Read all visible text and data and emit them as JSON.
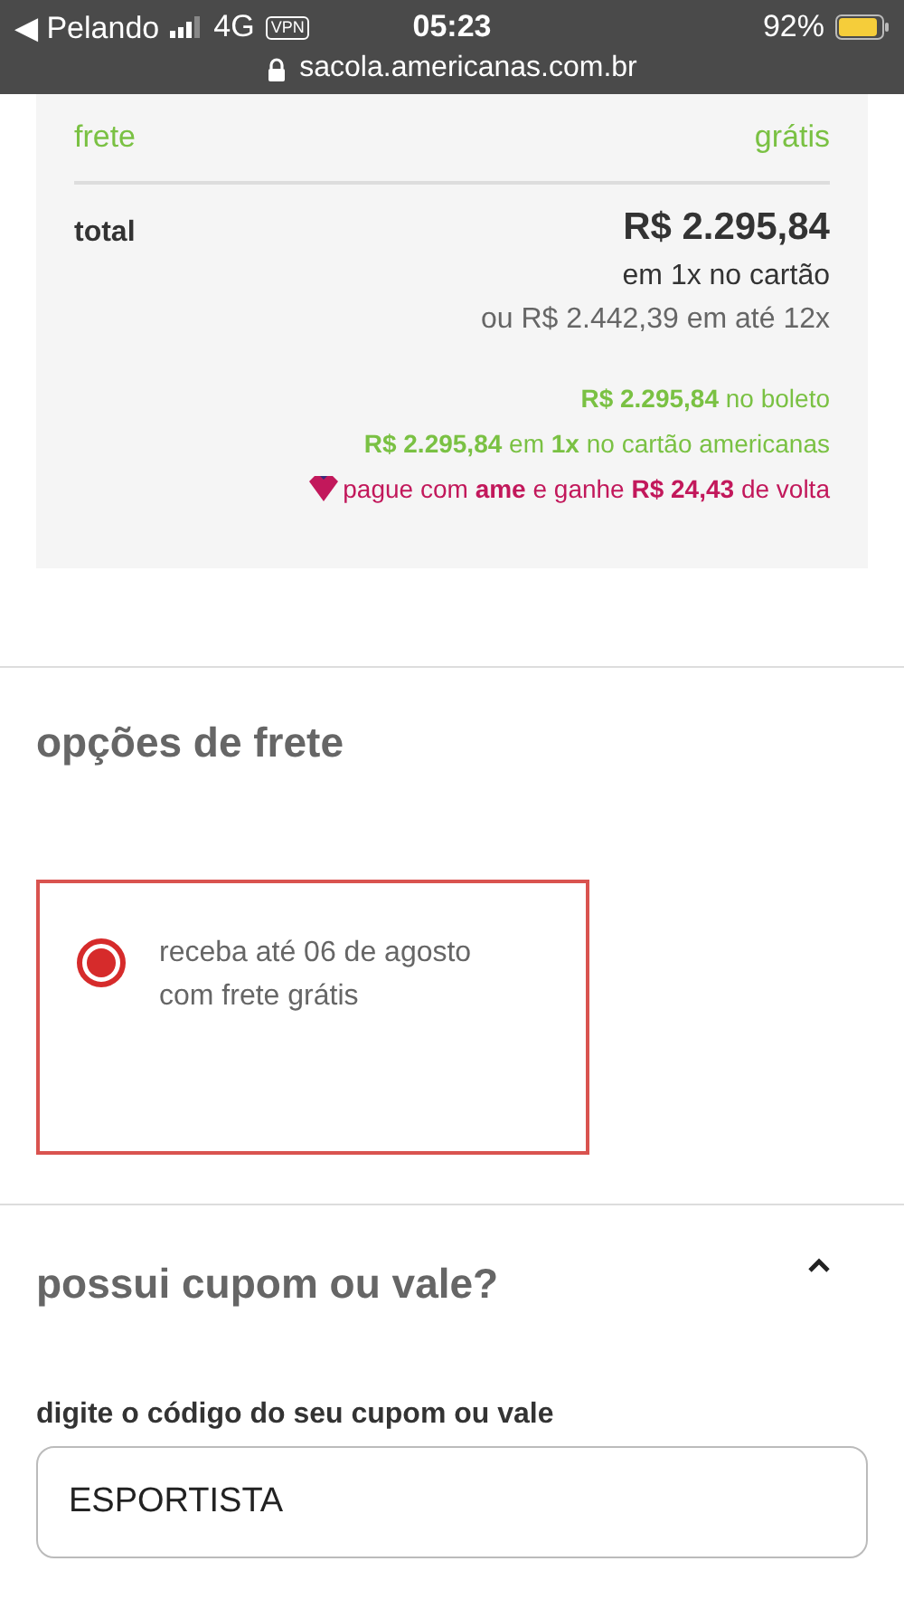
{
  "status_bar": {
    "back_app": "◀ Pelando",
    "network": "4G",
    "vpn": "VPN",
    "time": "05:23",
    "battery": "92%",
    "url": "sacola.americanas.com.br"
  },
  "summary": {
    "shipping_label": "frete",
    "shipping_value": "grátis",
    "total_label": "total",
    "total_value": "R$ 2.295,84",
    "total_note": "em 1x no cartão",
    "installments": "ou R$ 2.442,39 em até 12x",
    "offers": [
      {
        "kind": "green",
        "text": "**R$ 2.295,84** no boleto"
      },
      {
        "kind": "green",
        "text": "**R$ 2.295,84** em **1x** no cartão americanas"
      },
      {
        "kind": "ame",
        "text": "pague com **ame** e ganhe **R$ 24,43** de volta"
      }
    ]
  },
  "shipping": {
    "title": "opções de frete",
    "options": [
      {
        "lines": [
          "receba até 06 de agosto",
          "com frete grátis"
        ],
        "selected": true
      }
    ]
  },
  "coupon": {
    "title": "possui cupom ou vale?",
    "expanded": true,
    "field_label": "digite o código do seu cupom ou vale",
    "value": "ESPORTISTA"
  }
}
